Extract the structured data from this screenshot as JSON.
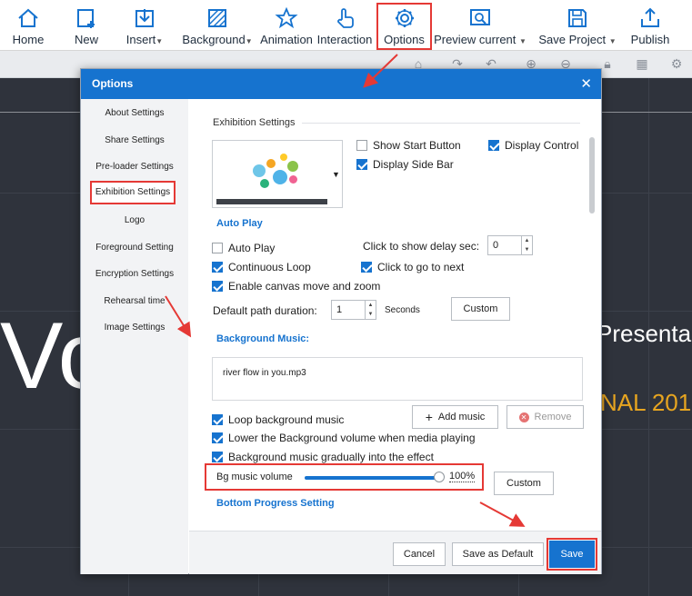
{
  "toolbar": {
    "home": "Home",
    "new": "New",
    "insert": "Insert",
    "background": "Background",
    "animation": "Animation",
    "interaction": "Interaction",
    "options": "Options",
    "preview_current": "Preview current",
    "save_project": "Save Project",
    "publish": "Publish"
  },
  "background_text": {
    "big_letters": "Vo",
    "presentation": "Presenta",
    "subtitle": "NAL 201"
  },
  "dialog": {
    "title": "Options",
    "close": "✕",
    "sidebar": {
      "items": [
        "About Settings",
        "Share Settings",
        "Pre-loader Settings",
        "Exhibition Settings",
        "Logo",
        "Foreground Setting",
        "Encryption Settings",
        "Rehearsal time",
        "Image Settings"
      ],
      "active": "Exhibition Settings"
    },
    "exhibition": {
      "heading": "Exhibition Settings",
      "show_start_button": "Show Start Button",
      "display_control": "Display Control",
      "display_side_bar": "Display Side Bar",
      "show_start_button_checked": false,
      "display_control_checked": true,
      "display_side_bar_checked": true
    },
    "autoplay": {
      "heading": "Auto Play",
      "auto_play": "Auto Play",
      "continuous_loop": "Continuous Loop",
      "enable_canvas": "Enable canvas move and zoom",
      "click_delay_label": "Click to show delay sec:",
      "click_delay_value": "0",
      "click_to_go_next": "Click to go to next",
      "default_path_label": "Default path duration:",
      "default_path_value": "1",
      "seconds": "Seconds",
      "custom": "Custom"
    },
    "music": {
      "heading": "Background Music:",
      "file": "river flow in you.mp3",
      "loop": "Loop background music",
      "lower_volume": "Lower the Background volume when media playing",
      "gradually": "Background music gradually into the effect",
      "add_music": "Add music",
      "remove": "Remove",
      "volume_label": "Bg music volume",
      "volume_pct": "100%",
      "volume_value": 1.0,
      "custom": "Custom"
    },
    "bottom_progress_heading": "Bottom Progress Setting",
    "footer": {
      "cancel": "Cancel",
      "save_default": "Save as Default",
      "save": "Save"
    }
  },
  "colors": {
    "accent": "#1673cf",
    "highlight": "#e53935",
    "canvas": "#2f333c",
    "subtitle": "#e7a520"
  }
}
